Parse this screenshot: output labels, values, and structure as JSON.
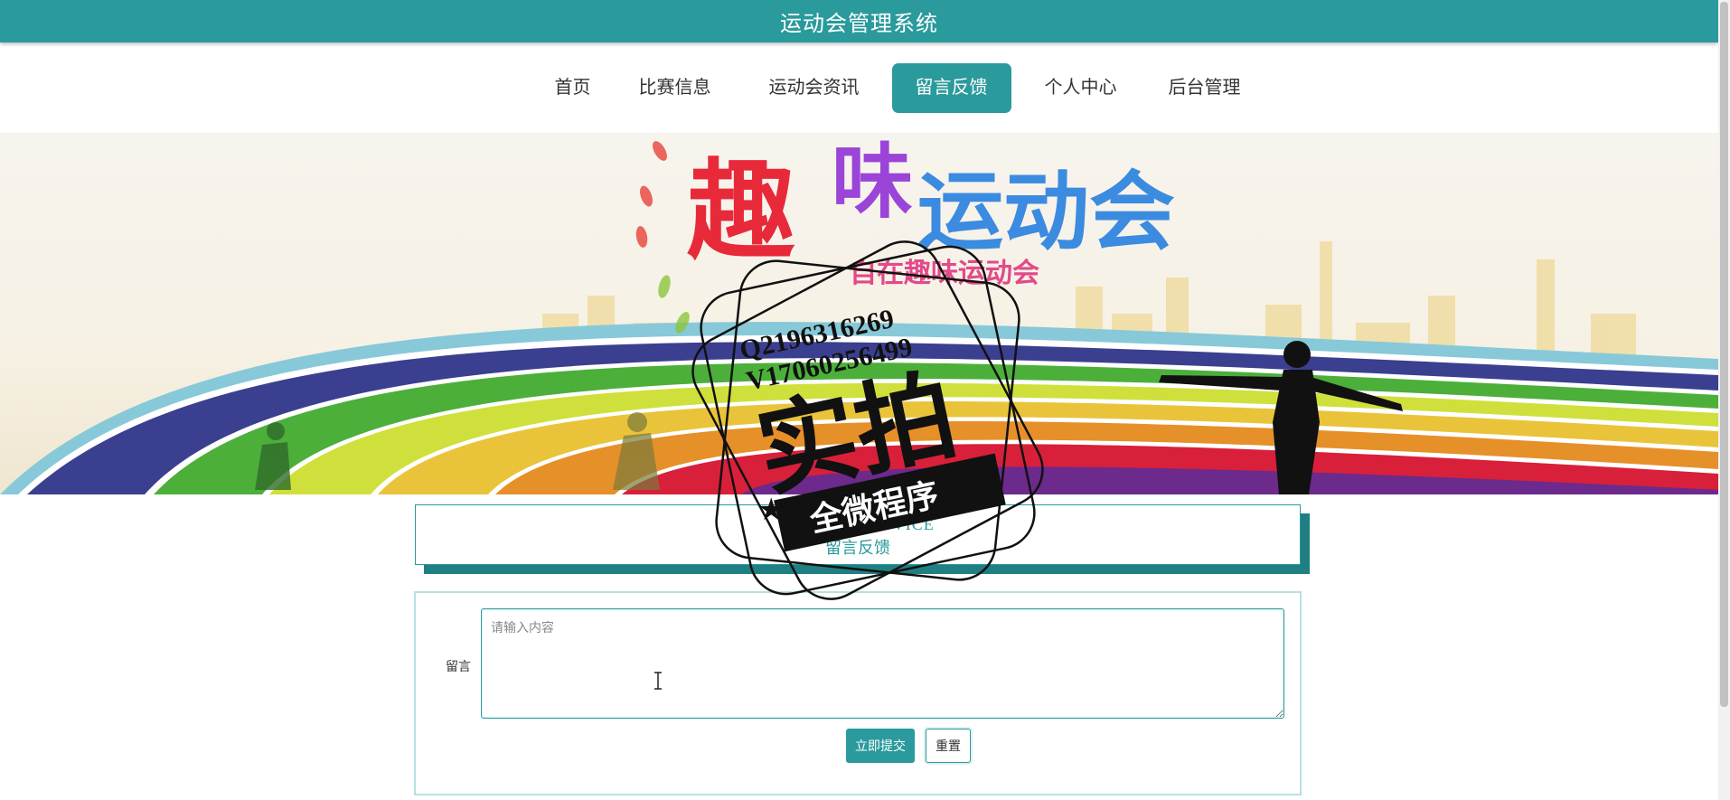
{
  "header": {
    "title": "运动会管理系统"
  },
  "nav": {
    "items": [
      {
        "label": "首页",
        "active": false
      },
      {
        "label": "比赛信息",
        "active": false
      },
      {
        "label": "运动会资讯",
        "active": false
      },
      {
        "label": "留言反馈",
        "active": true
      },
      {
        "label": "个人中心",
        "active": false
      },
      {
        "label": "后台管理",
        "active": false
      }
    ]
  },
  "banner": {
    "headline_chars": [
      "趣",
      "味",
      "运动会"
    ],
    "subtitle": "自在趣味运动会"
  },
  "watermark": {
    "line1": "Q2196316269",
    "line2": "V17060256499",
    "big": "实拍",
    "ribbon": "全微程序"
  },
  "section": {
    "title_en": "MESSAGE ADVICE",
    "title_zh": "留言反馈"
  },
  "form": {
    "label": "留言",
    "textarea_value": "",
    "textarea_placeholder": "请输入内容",
    "submit_label": "立即提交",
    "reset_label": "重置"
  },
  "colors": {
    "primary": "#2a9a9c",
    "shadow": "#1f7f83"
  }
}
